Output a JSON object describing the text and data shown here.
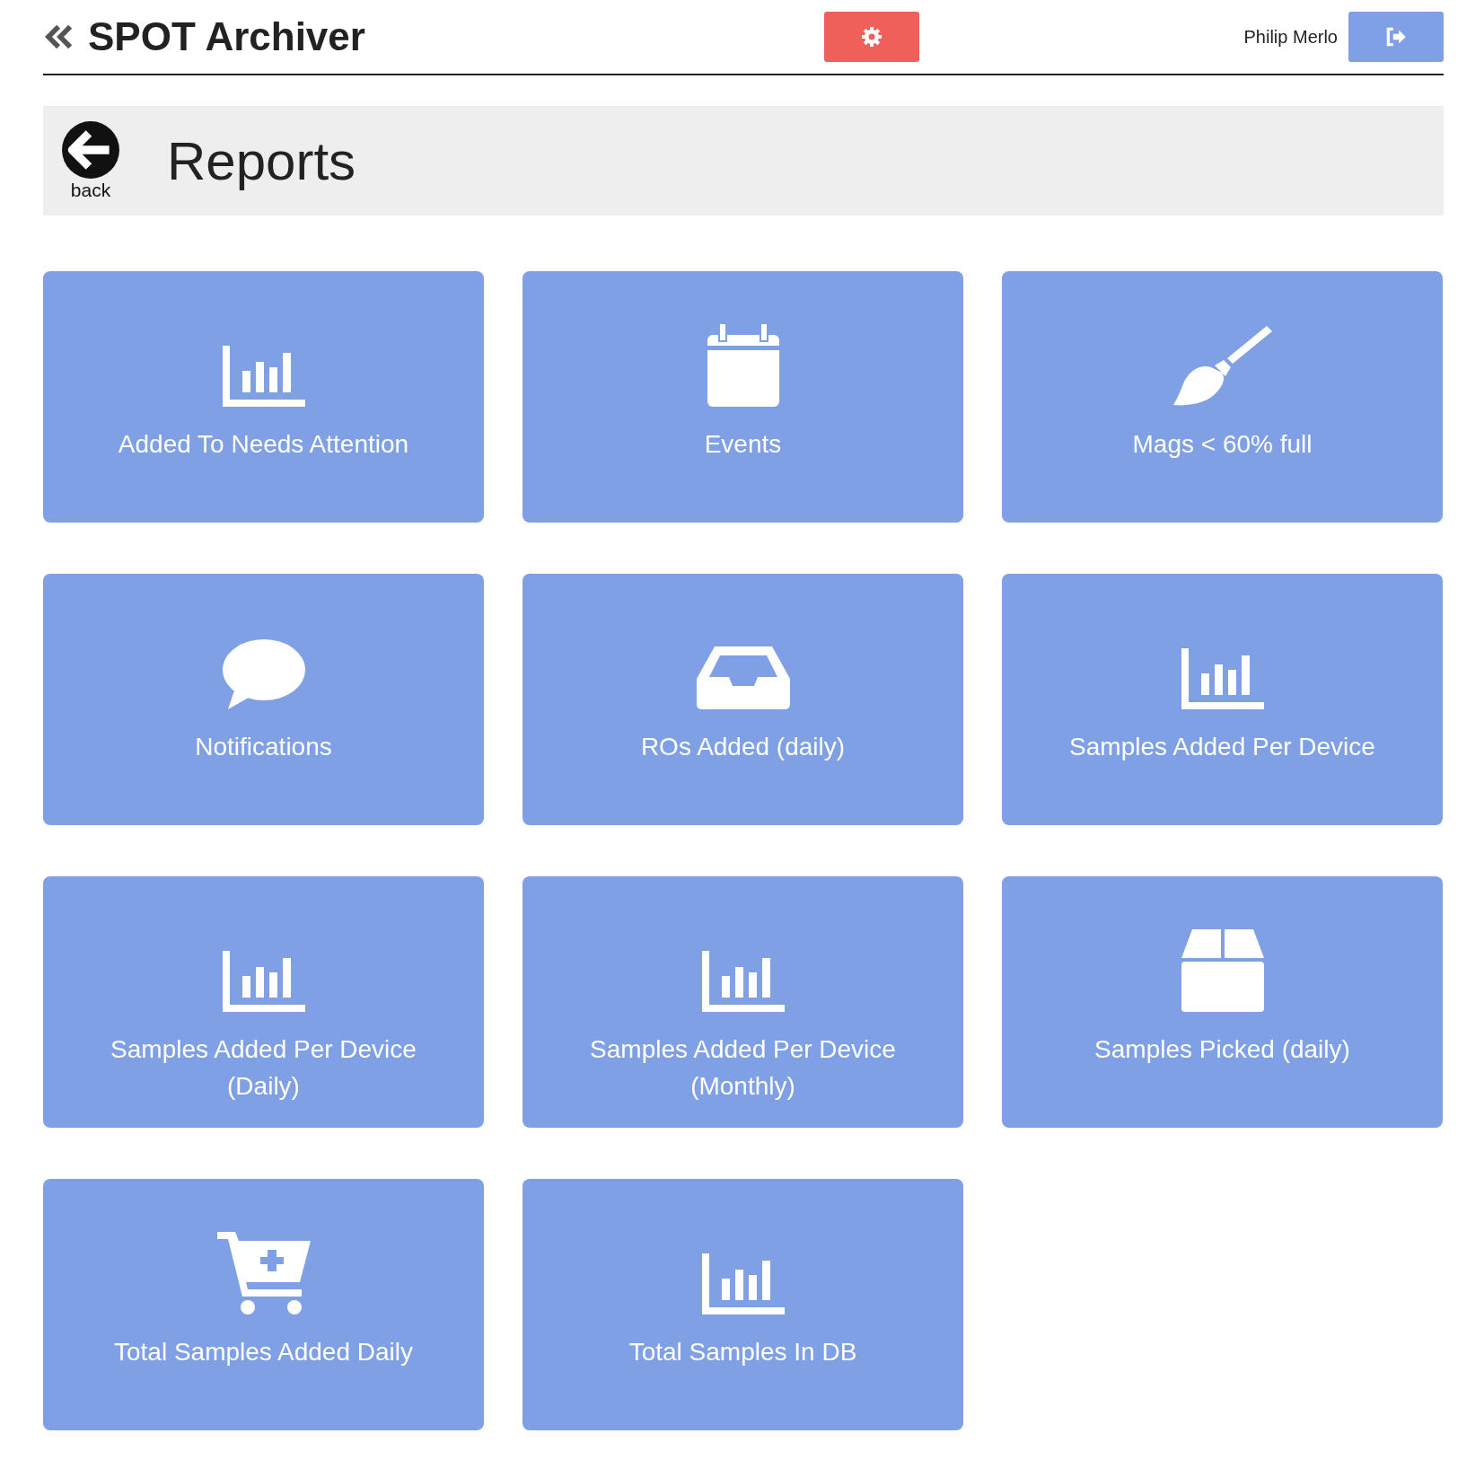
{
  "header": {
    "title": "SPOT Archiver",
    "user": "Philip Merlo"
  },
  "page": {
    "title": "Reports",
    "back_label": "back"
  },
  "tiles": [
    {
      "label": "Added To Needs Attention",
      "kind": "chart"
    },
    {
      "label": "Events",
      "kind": "calendar"
    },
    {
      "label": "Mags < 60% full",
      "kind": "brush"
    },
    {
      "label": "Notifications",
      "kind": "comment"
    },
    {
      "label": "ROs Added (daily)",
      "kind": "inbox"
    },
    {
      "label": "Samples Added Per Device",
      "kind": "chart"
    },
    {
      "label": "Samples Added Per Device (Daily)",
      "kind": "chart"
    },
    {
      "label": "Samples Added Per Device (Monthly)",
      "kind": "chart"
    },
    {
      "label": "Samples Picked (daily)",
      "kind": "box"
    },
    {
      "label": "Total Samples Added Daily",
      "kind": "cart"
    },
    {
      "label": "Total Samples In DB",
      "kind": "chart"
    }
  ]
}
